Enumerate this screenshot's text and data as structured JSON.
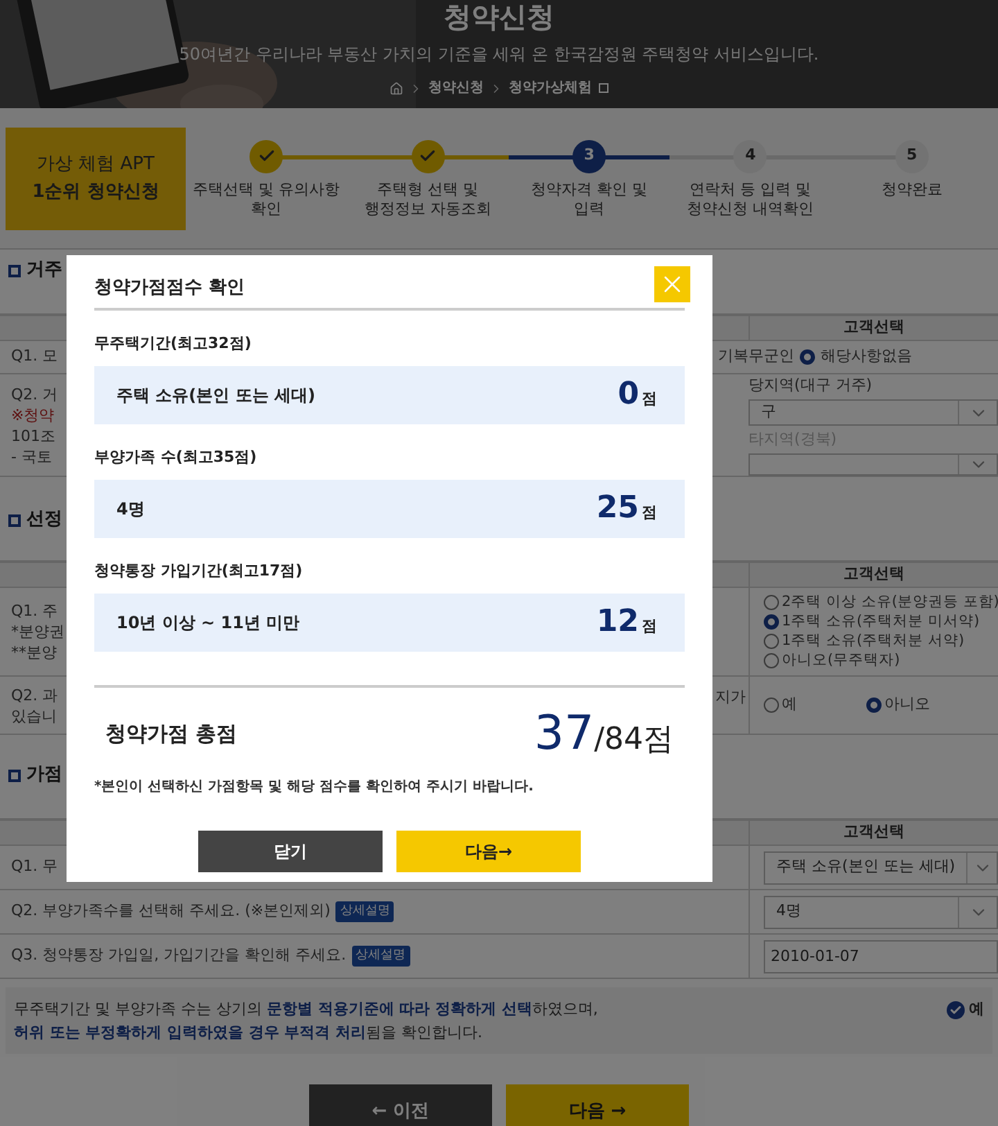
{
  "header": {
    "title": "청약신청",
    "subtitle": "50여년간 우리나라 부동산 가치의 기준을 세워 온 한국감정원 주택청약 서비스입니다.",
    "breadcrumb": [
      "청약신청",
      "청약가상체험"
    ]
  },
  "apt_badge": [
    "가상 체험 APT",
    "1순위 청약신청"
  ],
  "steps": [
    {
      "completed": true,
      "selected": false,
      "label": [
        "주택선택 및 유의사항",
        "확인"
      ]
    },
    {
      "completed": true,
      "selected": false,
      "label": [
        "주택형 선택 및",
        "행정정보 자동조회"
      ]
    },
    {
      "completed": false,
      "selected": true,
      "number": "3",
      "label": [
        "청약자격 확인 및",
        "입력"
      ]
    },
    {
      "completed": false,
      "selected": false,
      "number": "4",
      "label": [
        "연락처 등 입력 및",
        "청약신청 내역확인"
      ]
    },
    {
      "completed": false,
      "selected": false,
      "number": "5",
      "label": [
        "청약완료"
      ]
    }
  ],
  "residence": {
    "title": "거주",
    "column_header": "고객선택",
    "q1": {
      "question": "Q1. 모",
      "note": "기복무군인",
      "option": {
        "label": "해당사항없음",
        "selected": true
      }
    },
    "q2": {
      "lines": [
        "Q2. 거",
        "※청약",
        "101조",
        "- 국토"
      ],
      "label_1": "당지역(대구 거주)",
      "select_1": "구",
      "label_2": "타지역(경북)"
    }
  },
  "selection": {
    "title": "선정",
    "column_header": "고객선택",
    "q1": {
      "lines": [
        "Q1. 주",
        "*분양권",
        "**분양"
      ],
      "options": [
        {
          "label": "2주택 이상 소유(분양권등 포함)",
          "selected": false
        },
        {
          "label": "1주택 소유(주택처분 미서약)",
          "selected": true
        },
        {
          "label": "1주택 소유(주택처분 서약)",
          "selected": false
        },
        {
          "label": "아니오(무주택자)",
          "selected": false
        }
      ]
    },
    "q2": {
      "lines": [
        "Q2. 과",
        "있습니"
      ],
      "cut_text": "지가",
      "options": [
        {
          "label": "예",
          "selected": false
        },
        {
          "label": "아니오",
          "selected": true
        }
      ]
    }
  },
  "points": {
    "title": "가점",
    "column_header": "고객선택",
    "rows": [
      {
        "kind": "select",
        "question": "Q1. 무",
        "value": "주택 소유(본인 또는 세대)"
      },
      {
        "kind": "select",
        "question": "Q2. 부양가족수를 선택해 주세요. (※본인제외)",
        "badge": "상세설명",
        "value": "4명"
      },
      {
        "kind": "input",
        "question": "Q3. 청약통장 가입일, 가입기간을 확인해 주세요.",
        "badge": "상세설명",
        "value": "2010-01-07"
      }
    ]
  },
  "agreement": {
    "lines": [
      "무주택기간 및 부양가족 수는 상기의 **문항별 적용기준에 따라 정확하게 선택**하였으며,",
      "**허위 또는 부정확하게 입력하였을 경우 부적격 처리**됨을 확인합니다."
    ],
    "checkbox": {
      "label": "예",
      "checked": true
    }
  },
  "nav_buttons": {
    "prev": "← 이전",
    "next": "다음 →"
  },
  "modal": {
    "title": "청약가점점수 확인",
    "items": [
      {
        "heading": "무주택기간(최고32점)",
        "answer": "주택 소유(본인 또는 세대)",
        "score": "0",
        "unit": "점"
      },
      {
        "heading": "부양가족 수(최고35점)",
        "answer": "4명",
        "score": "25",
        "unit": "점"
      },
      {
        "heading": "청약통장 가입기간(최고17점)",
        "answer": "10년 이상 ~ 11년 미만",
        "score": "12",
        "unit": "점"
      }
    ],
    "total": {
      "label": "청약가점 총점",
      "score": "37",
      "max": "/84점"
    },
    "note": "*본인이 선택하신 가점항목 및 해당 점수를 확인하여 주시기 바랍니다.",
    "buttons": {
      "close": "닫기",
      "next": "다음→"
    }
  }
}
